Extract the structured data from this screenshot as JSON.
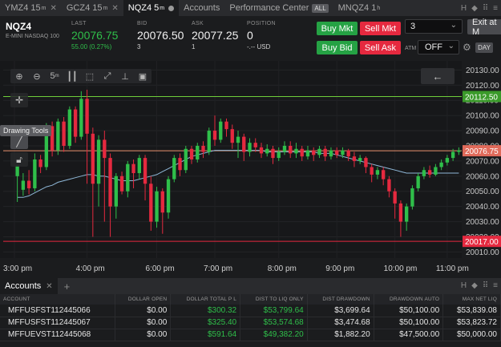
{
  "tabs": [
    {
      "label": "YMZ4 15",
      "sup": "m",
      "closable": true,
      "active": false
    },
    {
      "label": "GCZ4 15",
      "sup": "m",
      "closable": true,
      "active": false
    },
    {
      "label": "NQZ4 5",
      "sup": "m",
      "closable": false,
      "active": true
    },
    {
      "label": "Accounts",
      "sup": "",
      "closable": false,
      "active": false
    },
    {
      "label": "Performance Center",
      "sup": "",
      "closable": false,
      "active": false,
      "badge": "ALL"
    },
    {
      "label": "MNQZ4 1",
      "sup": "h",
      "closable": false,
      "active": false
    }
  ],
  "window_controls": [
    "H",
    "◆",
    "⠿",
    "≡"
  ],
  "quote": {
    "symbol": "NQZ4",
    "description": "E-MINI NASDAQ 100",
    "last_label": "LAST",
    "last": "20076.75",
    "change": "55.00 (0.27%)",
    "bid_label": "BID",
    "bid": "20076.50",
    "bid_size": "3",
    "ask_label": "ASK",
    "ask": "20077.25",
    "ask_size": "1",
    "position_label": "POSITION",
    "position": "0",
    "position_pl": "-.-- USD"
  },
  "order": {
    "buy_mkt": "Buy Mkt",
    "sell_mkt": "Sell Mkt",
    "buy_bid": "Buy Bid",
    "sell_ask": "Sell Ask",
    "quantity": "3",
    "exit": "Exit at M",
    "atm_label": "ATM",
    "atm_value": "OFF",
    "day": "DAY"
  },
  "chart_toolbar": {
    "timeframe": "5",
    "timeframe_sup": "m"
  },
  "tooltip": "Drawing Tools",
  "chart_data": {
    "type": "candlestick",
    "symbol": "NQZ4",
    "interval": "5m",
    "x_ticks": [
      "3:00 pm",
      "4:00 pm",
      "6:00 pm",
      "7:00 pm",
      "8:00 pm",
      "9:00 pm",
      "10:00 pm",
      "11:00 pm"
    ],
    "y_ticks": [
      20130,
      20120,
      20110,
      20100,
      20090,
      20080,
      20070,
      20060,
      20050,
      20040,
      20030,
      20020,
      20010
    ],
    "ylim": [
      20006,
      20136
    ],
    "price_labels": [
      {
        "value": "20112.50",
        "color": "#3a9a2a"
      },
      {
        "value": "20076.75",
        "color": "#e06a5a"
      },
      {
        "value": "20017.00",
        "color": "#e5293f"
      }
    ],
    "horizontal_lines": [
      {
        "value": 20112.5,
        "color": "#6fcf3a"
      },
      {
        "value": 20076.75,
        "color": "#e8926e"
      },
      {
        "value": 20017.0,
        "color": "#e5293f"
      },
      {
        "value": 20072.0,
        "color": "#d9d9d9"
      }
    ],
    "candles": [
      [
        20060,
        20067,
        20051,
        20043
      ],
      [
        20051,
        20057,
        20062,
        20047
      ],
      [
        20057,
        20052,
        20064,
        20048
      ],
      [
        20052,
        20071,
        20075,
        20050
      ],
      [
        20071,
        20066,
        20074,
        20062
      ],
      [
        20066,
        20093,
        20095,
        20064
      ],
      [
        20093,
        20077,
        20096,
        20073
      ],
      [
        20077,
        20096,
        20098,
        20074
      ],
      [
        20096,
        20080,
        20099,
        20076
      ],
      [
        20080,
        20104,
        20106,
        20078
      ],
      [
        20104,
        20086,
        20106,
        20082
      ],
      [
        20086,
        20111,
        20116,
        20084
      ],
      [
        20111,
        20088,
        20117,
        20055
      ],
      [
        20088,
        20055,
        20092,
        20020
      ],
      [
        20055,
        20084,
        20087,
        20040
      ],
      [
        20084,
        20072,
        20090,
        20030
      ],
      [
        20072,
        20040,
        20075,
        20020
      ],
      [
        20040,
        20060,
        20062,
        20032
      ],
      [
        20060,
        20050,
        20063,
        20048
      ],
      [
        20050,
        20068,
        20070,
        20046
      ],
      [
        20068,
        20062,
        20071,
        20052
      ],
      [
        20062,
        20072,
        20074,
        20058
      ],
      [
        20072,
        20055,
        20074,
        20044
      ],
      [
        20055,
        20030,
        20060,
        20024
      ],
      [
        20030,
        20050,
        20053,
        20026
      ],
      [
        20050,
        20036,
        20052,
        20022
      ],
      [
        20036,
        20058,
        20060,
        20032
      ],
      [
        20058,
        20072,
        20074,
        20056
      ],
      [
        20072,
        20064,
        20075,
        20060
      ],
      [
        20064,
        20078,
        20080,
        20062
      ],
      [
        20078,
        20071,
        20080,
        20068
      ],
      [
        20071,
        20080,
        20082,
        20069
      ],
      [
        20080,
        20076,
        20083,
        20072
      ],
      [
        20076,
        20090,
        20092,
        20074
      ],
      [
        20090,
        20084,
        20100,
        20080
      ],
      [
        20084,
        20096,
        20098,
        20082
      ],
      [
        20096,
        20091,
        20098,
        20086
      ],
      [
        20091,
        20082,
        20094,
        20078
      ],
      [
        20082,
        20086,
        20090,
        20072
      ],
      [
        20086,
        20076,
        20088,
        20070
      ],
      [
        20076,
        20082,
        20085,
        20073
      ],
      [
        20082,
        20079,
        20085,
        20076
      ],
      [
        20079,
        20075,
        20082,
        20072
      ],
      [
        20075,
        20078,
        20081,
        20073
      ],
      [
        20078,
        20072,
        20080,
        20068
      ],
      [
        20072,
        20076,
        20079,
        20070
      ],
      [
        20076,
        20080,
        20083,
        20074
      ],
      [
        20080,
        20075,
        20083,
        20072
      ],
      [
        20075,
        20078,
        20082,
        20072
      ],
      [
        20078,
        20073,
        20080,
        20070
      ],
      [
        20073,
        20077,
        20080,
        20071
      ],
      [
        20077,
        20074,
        20079,
        20070
      ],
      [
        20074,
        20078,
        20080,
        20072
      ],
      [
        20078,
        20073,
        20080,
        20070
      ],
      [
        20073,
        20077,
        20079,
        20071
      ],
      [
        20077,
        20074,
        20079,
        20072
      ],
      [
        20074,
        20077,
        20079,
        20072
      ],
      [
        20077,
        20073,
        20078,
        20070
      ],
      [
        20073,
        20070,
        20076,
        20066
      ],
      [
        20070,
        20072,
        20074,
        20068
      ],
      [
        20072,
        20066,
        20073,
        20062
      ],
      [
        20066,
        20061,
        20068,
        20056
      ],
      [
        20061,
        20064,
        20066,
        20058
      ],
      [
        20064,
        20058,
        20066,
        20054
      ],
      [
        20058,
        20050,
        20060,
        20046
      ],
      [
        20050,
        20042,
        20052,
        20032
      ],
      [
        20042,
        20030,
        20044,
        20020
      ],
      [
        20030,
        20040,
        20042,
        20024
      ],
      [
        20040,
        20052,
        20054,
        20038
      ],
      [
        20052,
        20060,
        20062,
        20050
      ],
      [
        20060,
        20064,
        20066,
        20058
      ],
      [
        20064,
        20061,
        20067,
        20059
      ],
      [
        20061,
        20066,
        20068,
        20060
      ],
      [
        20066,
        20069,
        20071,
        20064
      ],
      [
        20069,
        20072,
        20074,
        20067
      ],
      [
        20072,
        20076,
        20078,
        20070
      ],
      [
        20076,
        20077,
        20079,
        20074
      ]
    ],
    "candle_fields": [
      "open",
      "close",
      "high",
      "low"
    ],
    "moving_average": {
      "color": "#8fb8d8",
      "values": [
        20046,
        20046,
        20047,
        20049,
        20051,
        20053,
        20054,
        20056,
        20057,
        20058,
        20059,
        20060,
        20061,
        20061,
        20060,
        20060,
        20059,
        20058,
        20057,
        20057,
        20057,
        20058,
        20059,
        20060,
        20061,
        20063,
        20065,
        20067,
        20069,
        20071,
        20073,
        20074,
        20075,
        20076,
        20077,
        20077,
        20077,
        20077,
        20077,
        20077,
        20077,
        20077,
        20077,
        20076,
        20076,
        20076,
        20076,
        20076,
        20076,
        20076,
        20076,
        20076,
        20075,
        20075,
        20075,
        20074,
        20073,
        20072,
        20071,
        20070,
        20069,
        20068,
        20067,
        20066,
        20065,
        20064,
        20063,
        20062,
        20062,
        20062,
        20062,
        20062,
        20062,
        20062,
        20062,
        20062,
        20062
      ]
    },
    "grid": true,
    "up_color": "#2fbf4a",
    "down_color": "#e5293f"
  },
  "accounts": {
    "tab": "Accounts",
    "columns": [
      "ACCOUNT",
      "DOLLAR OPEN",
      "DOLLAR TOTAL P L",
      "DIST TO LIQ ONLY",
      "DIST DRAWDOWN",
      "DRAWDOWN AUTO",
      "MAX NET LIQ"
    ],
    "rows": [
      [
        "MFFUSFST112445066",
        "$0.00",
        "$300.32",
        "$53,799.64",
        "$3,699.64",
        "$50,100.00",
        "$53,839.08"
      ],
      [
        "MFFUSFST112445067",
        "$0.00",
        "$325.40",
        "$53,574.68",
        "$3,474.68",
        "$50,100.00",
        "$53,823.72"
      ],
      [
        "MFFUEVST112445068",
        "$0.00",
        "$591.64",
        "$49,382.20",
        "$1,882.20",
        "$47,500.00",
        "$50,000.00"
      ]
    ],
    "positive_columns": [
      2,
      3
    ]
  }
}
